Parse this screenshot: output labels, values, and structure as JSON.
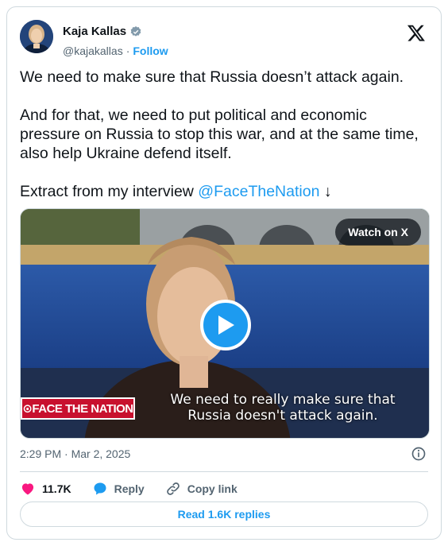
{
  "author": {
    "name": "Kaja Kallas",
    "handle": "@kajakallas",
    "separator": "·",
    "follow_label": "Follow"
  },
  "tweet": {
    "paragraph1": "We need to make sure that Russia doesn’t attack again.",
    "paragraph2": "And for that, we need to put political and economic pressure on Russia to stop this war, and at the same time, also help Ukraine defend itself.",
    "paragraph3_prefix": "Extract from my interview ",
    "mention": "@FaceTheNation",
    "paragraph3_suffix": " ↓"
  },
  "media": {
    "watch_label": "Watch on X",
    "caption_line1": "We need to really make sure that",
    "caption_line2": "Russia doesn't attack again.",
    "brand": "⊙FACE THE NATION"
  },
  "meta": {
    "timestamp": "2:29 PM · Mar 2, 2025"
  },
  "actions": {
    "likes": "11.7K",
    "reply_label": "Reply",
    "copy_link_label": "Copy link",
    "read_replies_label": "Read 1.6K replies"
  },
  "colors": {
    "accent": "#1d9bf0",
    "like": "#f91880",
    "border": "#cfd9de",
    "muted": "#536471"
  }
}
